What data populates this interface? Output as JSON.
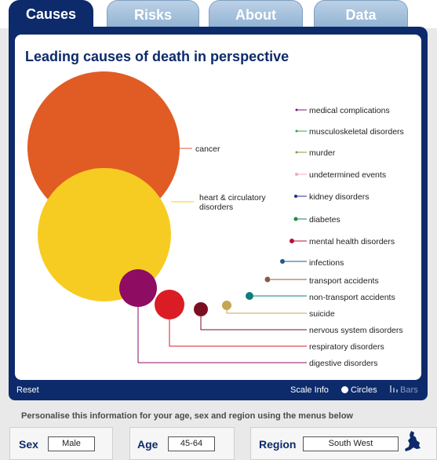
{
  "tabs": [
    {
      "label": "Causes",
      "active": true
    },
    {
      "label": "Risks",
      "active": false
    },
    {
      "label": "About",
      "active": false
    },
    {
      "label": "Data",
      "active": false
    }
  ],
  "title": "Leading causes of death in perspective",
  "causes": [
    {
      "label": "cancer",
      "color": "#e15b25"
    },
    {
      "label": "heart & circulatory disorders",
      "color": "#f7cc22"
    },
    {
      "label": "digestive disorders",
      "color": "#8e0c62"
    },
    {
      "label": "respiratory disorders",
      "color": "#dc1c24"
    },
    {
      "label": "nervous system disorders",
      "color": "#7a0e22"
    },
    {
      "label": "suicide",
      "color": "#c5a552"
    },
    {
      "label": "non-transport accidents",
      "color": "#107d7c"
    },
    {
      "label": "transport accidents",
      "color": "#8a5a44"
    },
    {
      "label": "infections",
      "color": "#21578e"
    },
    {
      "label": "mental health disorders",
      "color": "#b41235"
    },
    {
      "label": "diabetes",
      "color": "#198a48"
    },
    {
      "label": "kidney disorders",
      "color": "#1d2f8e"
    },
    {
      "label": "undetermined events",
      "color": "#f5a7bd"
    },
    {
      "label": "murder",
      "color": "#8f9a3c"
    },
    {
      "label": "musculoskeletal disorders",
      "color": "#3aa33a"
    },
    {
      "label": "medical complications",
      "color": "#7a1a7d"
    }
  ],
  "footer": {
    "reset": "Reset",
    "scale_info": "Scale Info",
    "circles": "Circles",
    "bars": "Bars",
    "selected_view": "Circles"
  },
  "personalise": "Personalise this information for your age, sex and region using the menus below",
  "selectors": {
    "sex": {
      "label": "Sex",
      "value": "Male"
    },
    "age": {
      "label": "Age",
      "value": "45-64"
    },
    "region": {
      "label": "Region",
      "value": "South West"
    }
  }
}
